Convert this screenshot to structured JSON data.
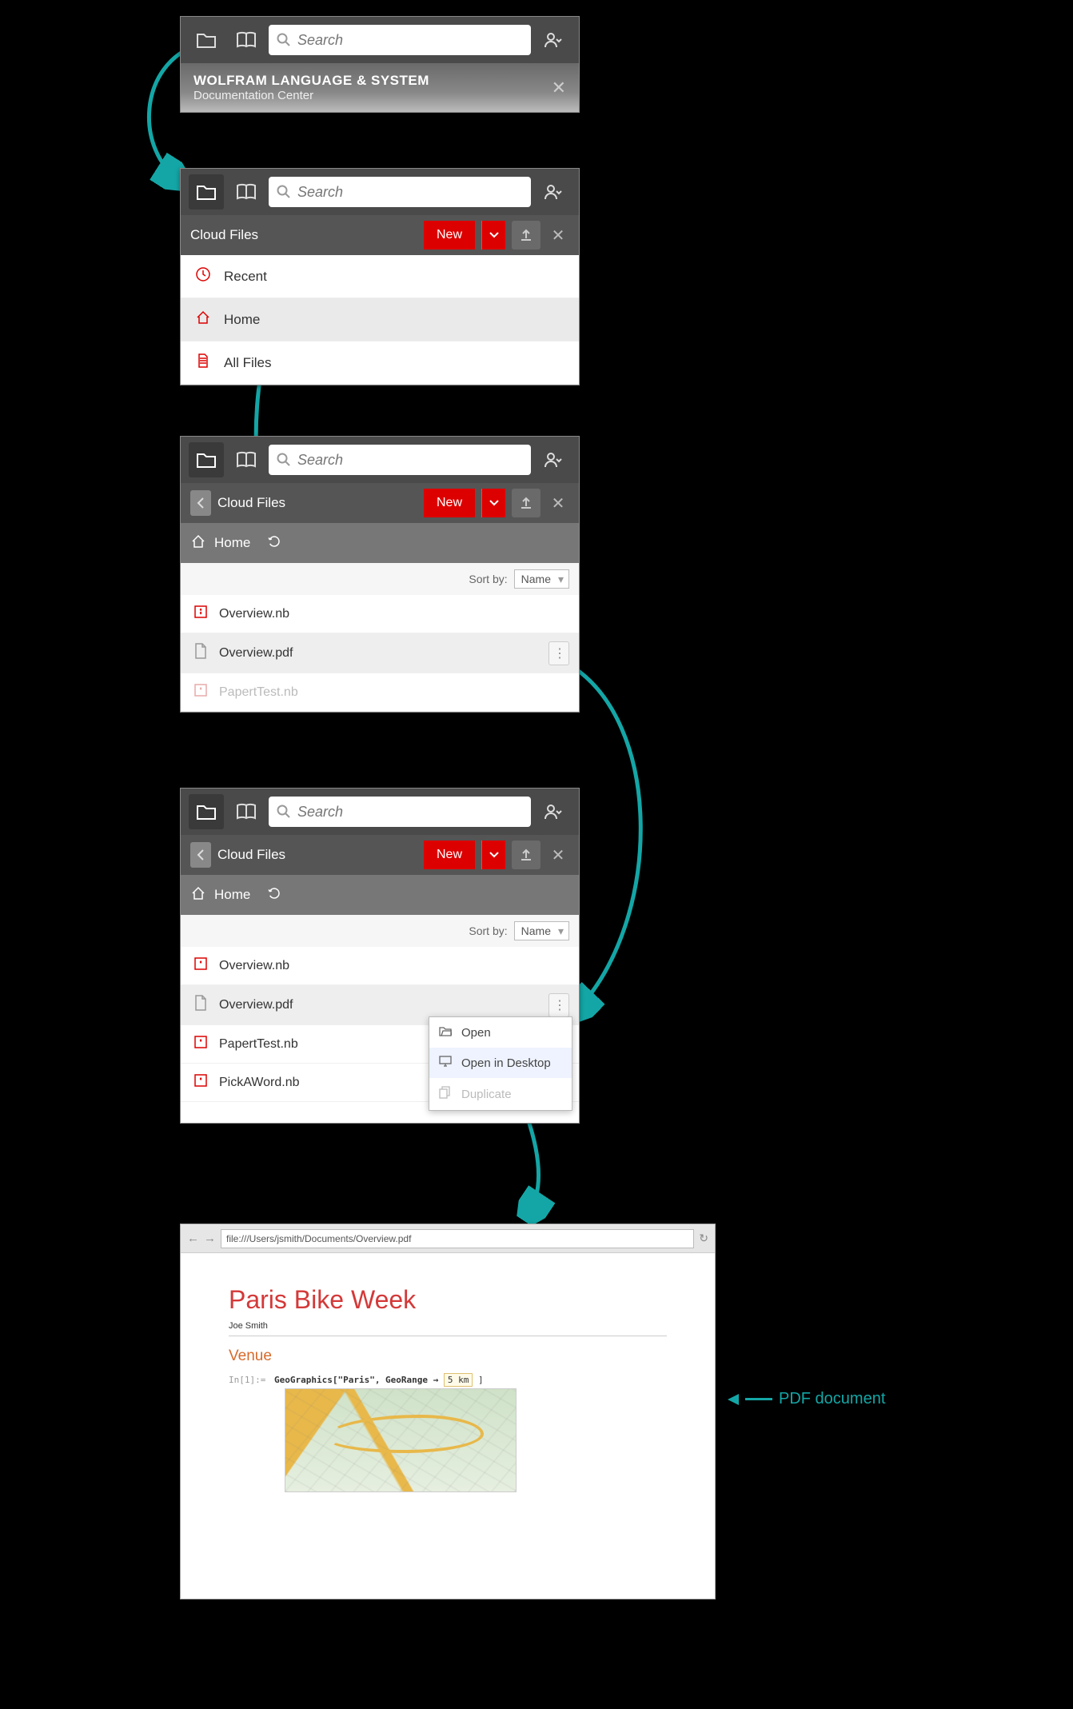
{
  "search_placeholder": "Search",
  "panel1": {
    "doc_title": "WOLFRAM LANGUAGE & SYSTEM",
    "doc_sub": "Documentation Center"
  },
  "panel2": {
    "header": "Cloud Files",
    "new_btn": "New",
    "nav": [
      "Recent",
      "Home",
      "All Files"
    ]
  },
  "panel3": {
    "back_label": "Cloud Files",
    "new_btn": "New",
    "crumb": "Home",
    "sort_label": "Sort by:",
    "sort_value": "Name",
    "files": [
      "Overview.nb",
      "Overview.pdf",
      "PapertTest.nb"
    ]
  },
  "panel4": {
    "back_label": "Cloud Files",
    "new_btn": "New",
    "crumb": "Home",
    "sort_label": "Sort by:",
    "sort_value": "Name",
    "files": [
      "Overview.nb",
      "Overview.pdf",
      "PapertTest.nb",
      "PickAWord.nb"
    ],
    "ctx": [
      "Open",
      "Open in Desktop",
      "Duplicate"
    ]
  },
  "browser": {
    "url": "file:///Users/jsmith/Documents/Overview.pdf",
    "title": "Paris Bike Week",
    "author": "Joe Smith",
    "section": "Venue",
    "code_prefix": "In[1]:=",
    "code": "GeoGraphics[\"Paris\", GeoRange → ",
    "code_qty": "5 km",
    "code_end": "]"
  },
  "annotation": "PDF document"
}
